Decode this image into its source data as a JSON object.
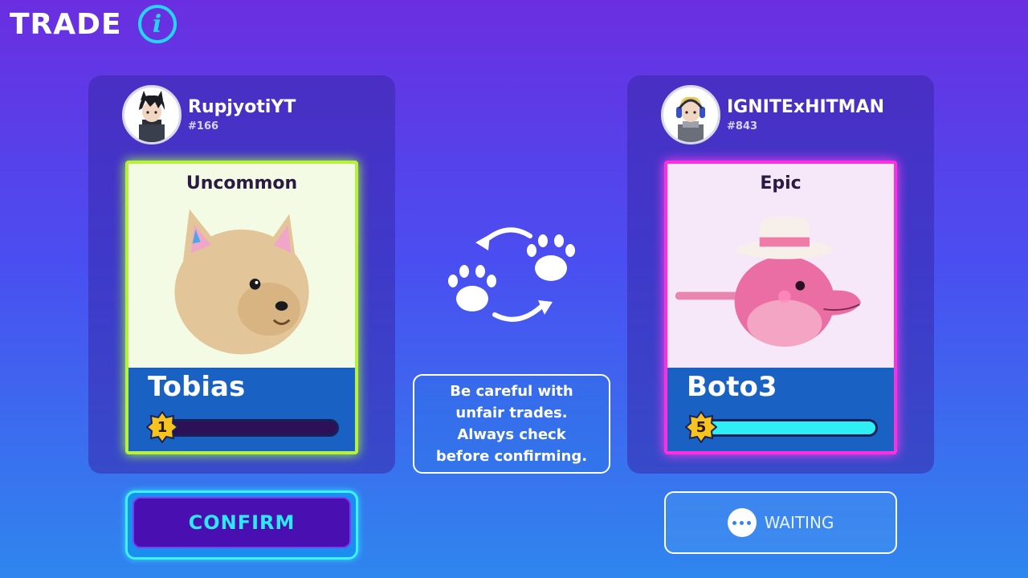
{
  "header": {
    "title": "TRADE",
    "info_icon": "info-icon"
  },
  "left_player": {
    "name": "RupjyotiYT",
    "id": "#166",
    "pet": {
      "rarity": "Uncommon",
      "name": "Tobias",
      "level": "1",
      "xp_fill": 0.0,
      "rarity_color": "#b6f23b"
    }
  },
  "right_player": {
    "name": "IGNITExHITMAN",
    "id": "#843",
    "pet": {
      "rarity": "Epic",
      "name": "Boto3",
      "level": "5",
      "xp_fill": 1.0,
      "rarity_color": "#ff2fe0"
    }
  },
  "center": {
    "swap_icon": "paw-swap-icon",
    "warning": "Be careful with\nunfair trades.\nAlways check\nbefore confirming."
  },
  "buttons": {
    "confirm": "CONFIRM",
    "waiting": "WAITING"
  },
  "colors": {
    "accent": "#27d4f5",
    "confirm_bg": "#4a0fb0",
    "xp_full": "#2ef0f4"
  }
}
